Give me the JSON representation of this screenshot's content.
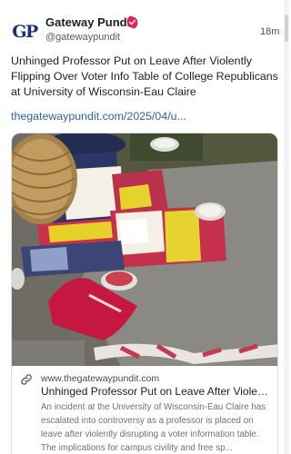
{
  "post": {
    "author": {
      "name": "Gateway Pundit",
      "handle": "@gatewaypundit",
      "avatar_text": "GP",
      "verified": true
    },
    "timestamp": "18m",
    "text": "Unhinged Professor Put on Leave After Violently Flipping Over Voter Info Table of College Republicans at University of Wisconsin-Eau Claire",
    "link_text": "thegatewaypundit.com/2025/04/u...",
    "link_card": {
      "domain": "www.thegatewaypundit.com",
      "title": "Unhinged Professor Put on Leave After Violent...",
      "description": "An incident at the University of Wisconsin-Eau Claire has escalated into controversy as a professor is placed on leave after violently disrupting a voter information table. The implications for campus civility and free sp..."
    }
  },
  "colors": {
    "badge": "#e0245e",
    "link": "#2f5fb3",
    "avatar_text": "#1a3370"
  }
}
